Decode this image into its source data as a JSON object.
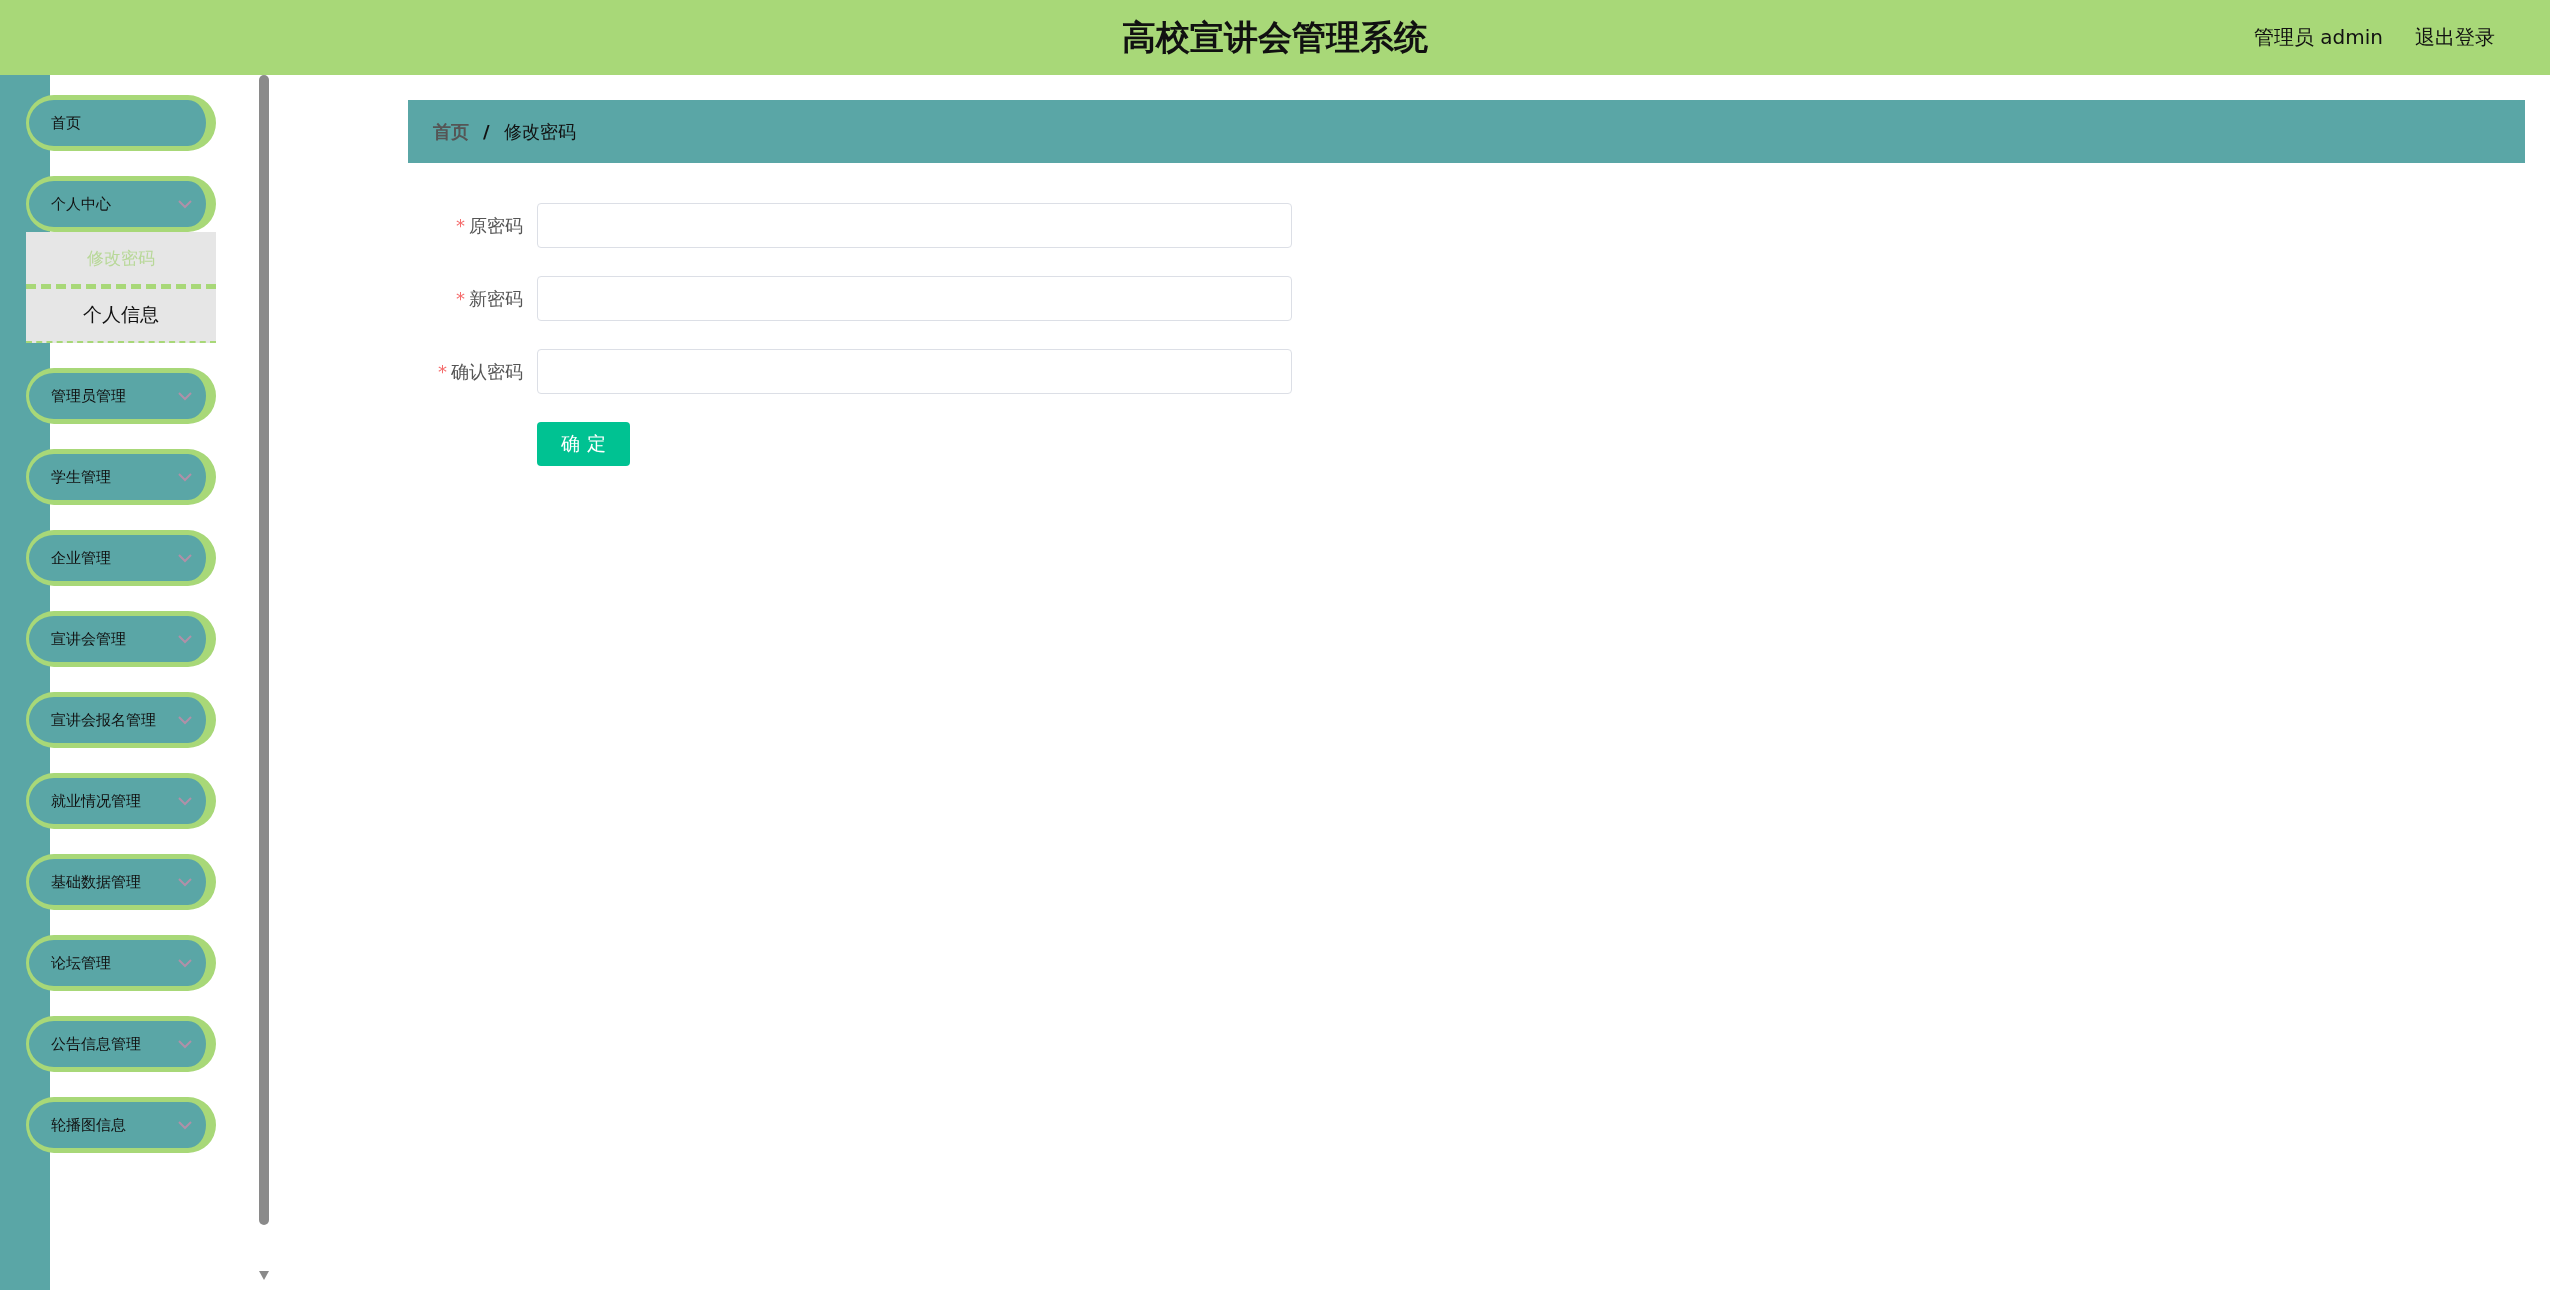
{
  "header": {
    "title": "高校宣讲会管理系统",
    "user": "管理员 admin",
    "logout": "退出登录"
  },
  "sidebar": {
    "items": [
      {
        "label": "首页",
        "kind": "link"
      },
      {
        "label": "个人中心",
        "kind": "group",
        "children": [
          {
            "label": "修改密码",
            "selected": true
          },
          {
            "label": "个人信息",
            "selected": false
          }
        ]
      },
      {
        "label": "管理员管理",
        "kind": "group"
      },
      {
        "label": "学生管理",
        "kind": "group"
      },
      {
        "label": "企业管理",
        "kind": "group"
      },
      {
        "label": "宣讲会管理",
        "kind": "group"
      },
      {
        "label": "宣讲会报名管理",
        "kind": "group"
      },
      {
        "label": "就业情况管理",
        "kind": "group"
      },
      {
        "label": "基础数据管理",
        "kind": "group"
      },
      {
        "label": "论坛管理",
        "kind": "group"
      },
      {
        "label": "公告信息管理",
        "kind": "group"
      },
      {
        "label": "轮播图信息",
        "kind": "group"
      }
    ]
  },
  "breadcrumb": [
    {
      "label": "首页"
    },
    {
      "label": "修改密码"
    }
  ],
  "breadcrumb_separator": "/",
  "form": {
    "fields": [
      {
        "label": "原密码",
        "required": true
      },
      {
        "label": "新密码",
        "required": true
      },
      {
        "label": "确认密码",
        "required": true
      }
    ],
    "required_mark": "*",
    "submit": "确 定"
  }
}
